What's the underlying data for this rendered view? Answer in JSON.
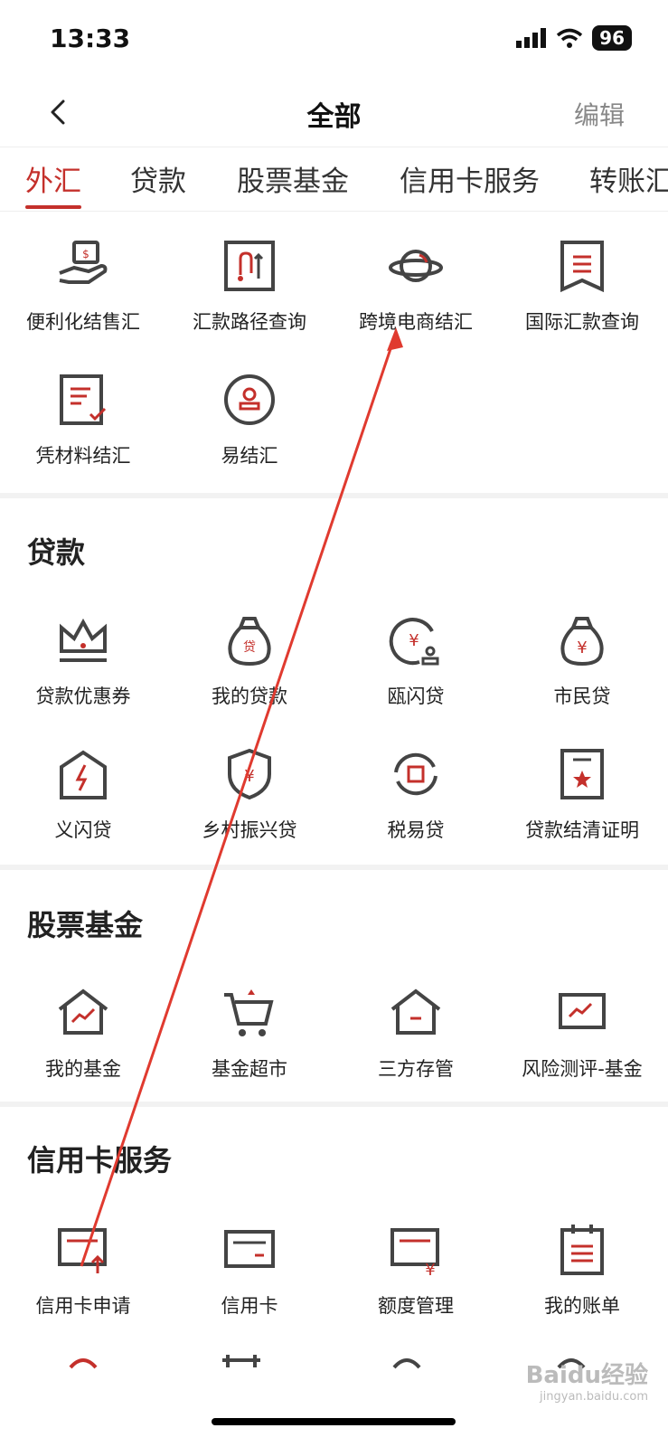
{
  "status_bar": {
    "time": "13:33",
    "battery": "96"
  },
  "nav": {
    "title": "全部",
    "edit": "编辑"
  },
  "tabs": [
    "外汇",
    "贷款",
    "股票基金",
    "信用卡服务",
    "转账汇"
  ],
  "sections": {
    "forex": {
      "items": [
        "便利化结售汇",
        "汇款路径查询",
        "跨境电商结汇",
        "国际汇款查询",
        "凭材料结汇",
        "易结汇"
      ]
    },
    "loan": {
      "title": "贷款",
      "items": [
        "贷款优惠券",
        "我的贷款",
        "瓯闪贷",
        "市民贷",
        "义闪贷",
        "乡村振兴贷",
        "税易贷",
        "贷款结清证明"
      ]
    },
    "fund": {
      "title": "股票基金",
      "items": [
        "我的基金",
        "基金超市",
        "三方存管",
        "风险测评-基金"
      ]
    },
    "credit": {
      "title": "信用卡服务",
      "items": [
        "信用卡申请",
        "信用卡",
        "额度管理",
        "我的账单"
      ]
    }
  },
  "watermark": {
    "brand": "Baidu经验",
    "url": "jingyan.baidu.com"
  },
  "colors": {
    "accent": "#c4302b",
    "icon_stroke": "#444444"
  }
}
